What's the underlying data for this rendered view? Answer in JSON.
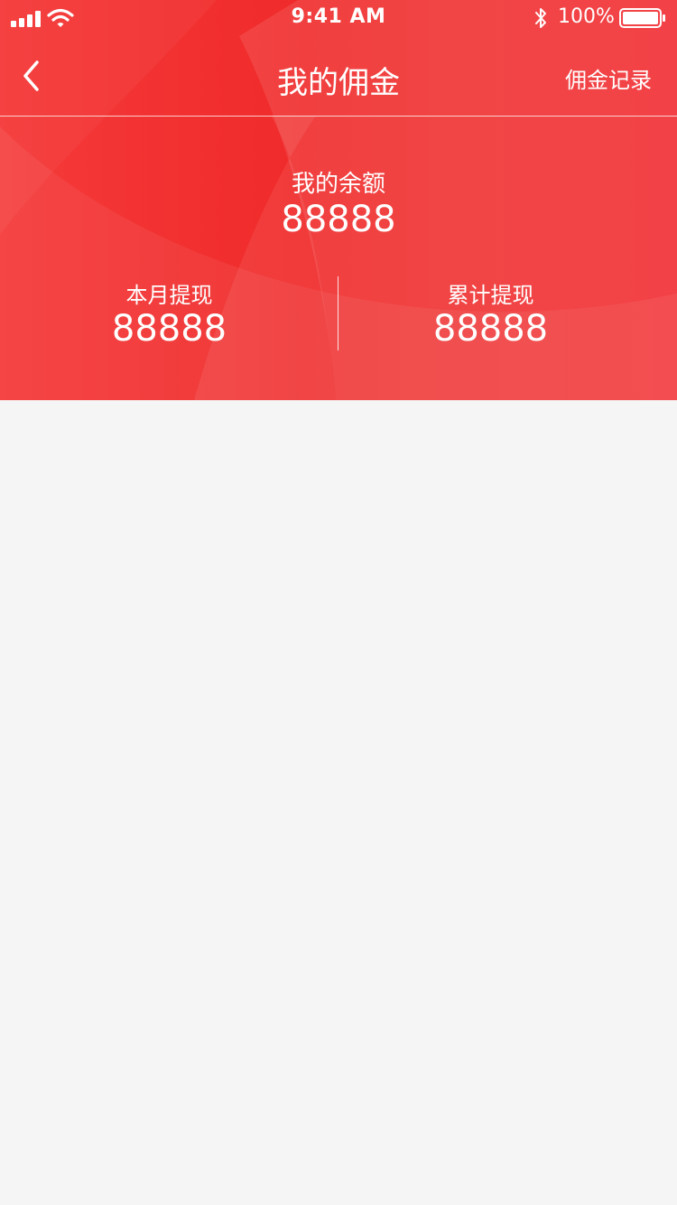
{
  "status_bar": {
    "time": "9:41 AM",
    "battery": "100%"
  },
  "nav": {
    "title": "我的佣金",
    "records_link": "佣金记录"
  },
  "balance": {
    "label": "我的余额",
    "value": "88888"
  },
  "stats": [
    {
      "label": "本月提现",
      "value": "88888"
    },
    {
      "label": "累计提现",
      "value": "88888"
    }
  ],
  "colors": {
    "header_red": "#f02a2a",
    "background": "#f5f5f5",
    "text_on_header": "#ffffff"
  },
  "icons": [
    "signal-icon",
    "wifi-icon",
    "bluetooth-icon",
    "battery-icon",
    "back-arrow-icon"
  ]
}
